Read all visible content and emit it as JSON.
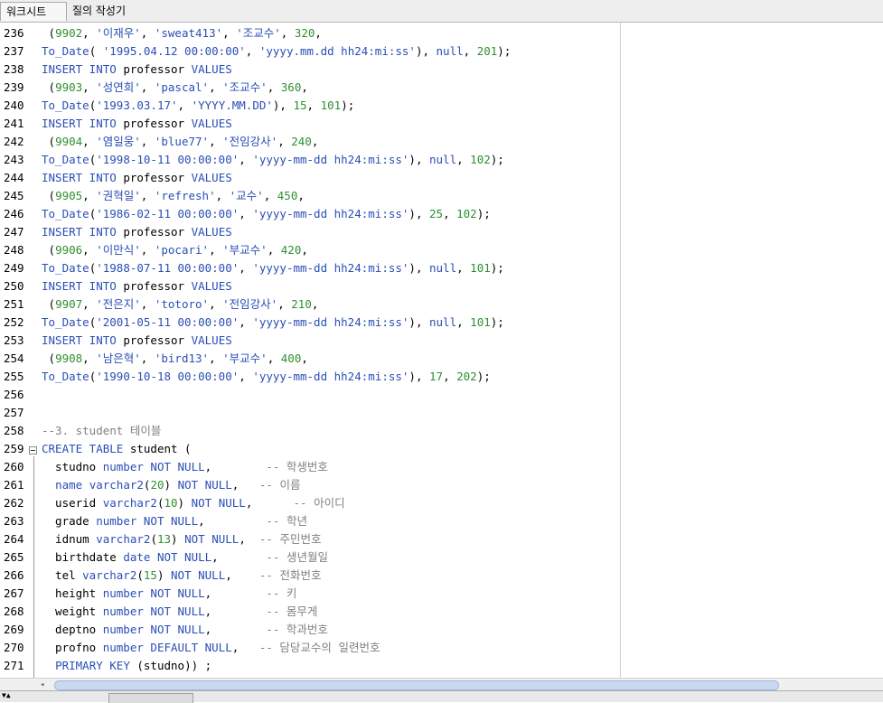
{
  "tabs": [
    {
      "label": "워크시트",
      "active": true
    },
    {
      "label": "질의 작성기",
      "active": false
    }
  ],
  "colors": {
    "keyword": "#2a4fb6",
    "number": "#2f8f2f",
    "comment": "#808080"
  },
  "lines": [
    {
      "n": "236",
      "tokens": [
        [
          "p",
          " ("
        ],
        [
          "num",
          "9902"
        ],
        [
          "p",
          ", "
        ],
        [
          "str",
          "'이재우'"
        ],
        [
          "p",
          ", "
        ],
        [
          "str",
          "'sweat413'"
        ],
        [
          "p",
          ", "
        ],
        [
          "str",
          "'조교수'"
        ],
        [
          "p",
          ", "
        ],
        [
          "num",
          "320"
        ],
        [
          "p",
          ","
        ]
      ]
    },
    {
      "n": "237",
      "tokens": [
        [
          "kw",
          "To_Date"
        ],
        [
          "p",
          "( "
        ],
        [
          "str",
          "'1995.04.12 00:00:00'"
        ],
        [
          "p",
          ", "
        ],
        [
          "str",
          "'yyyy.mm.dd hh24:mi:ss'"
        ],
        [
          "p",
          "), "
        ],
        [
          "kw",
          "null"
        ],
        [
          "p",
          ", "
        ],
        [
          "num",
          "201"
        ],
        [
          "p",
          ");"
        ]
      ]
    },
    {
      "n": "238",
      "tokens": [
        [
          "kw",
          "INSERT INTO"
        ],
        [
          "p",
          " professor "
        ],
        [
          "kw",
          "VALUES"
        ]
      ]
    },
    {
      "n": "239",
      "tokens": [
        [
          "p",
          " ("
        ],
        [
          "num",
          "9903"
        ],
        [
          "p",
          ", "
        ],
        [
          "str",
          "'성연희'"
        ],
        [
          "p",
          ", "
        ],
        [
          "str",
          "'pascal'"
        ],
        [
          "p",
          ", "
        ],
        [
          "str",
          "'조교수'"
        ],
        [
          "p",
          ", "
        ],
        [
          "num",
          "360"
        ],
        [
          "p",
          ","
        ]
      ]
    },
    {
      "n": "240",
      "tokens": [
        [
          "kw",
          "To_Date"
        ],
        [
          "p",
          "("
        ],
        [
          "str",
          "'1993.03.17'"
        ],
        [
          "p",
          ", "
        ],
        [
          "str",
          "'YYYY.MM.DD'"
        ],
        [
          "p",
          "), "
        ],
        [
          "num",
          "15"
        ],
        [
          "p",
          ", "
        ],
        [
          "num",
          "101"
        ],
        [
          "p",
          ");"
        ]
      ]
    },
    {
      "n": "241",
      "tokens": [
        [
          "kw",
          "INSERT INTO"
        ],
        [
          "p",
          " professor "
        ],
        [
          "kw",
          "VALUES"
        ]
      ]
    },
    {
      "n": "242",
      "tokens": [
        [
          "p",
          " ("
        ],
        [
          "num",
          "9904"
        ],
        [
          "p",
          ", "
        ],
        [
          "str",
          "'염일웅'"
        ],
        [
          "p",
          ", "
        ],
        [
          "str",
          "'blue77'"
        ],
        [
          "p",
          ", "
        ],
        [
          "str",
          "'전임강사'"
        ],
        [
          "p",
          ", "
        ],
        [
          "num",
          "240"
        ],
        [
          "p",
          ","
        ]
      ]
    },
    {
      "n": "243",
      "tokens": [
        [
          "kw",
          "To_Date"
        ],
        [
          "p",
          "("
        ],
        [
          "str",
          "'1998-10-11 00:00:00'"
        ],
        [
          "p",
          ", "
        ],
        [
          "str",
          "'yyyy-mm-dd hh24:mi:ss'"
        ],
        [
          "p",
          "), "
        ],
        [
          "kw",
          "null"
        ],
        [
          "p",
          ", "
        ],
        [
          "num",
          "102"
        ],
        [
          "p",
          ");"
        ]
      ]
    },
    {
      "n": "244",
      "tokens": [
        [
          "kw",
          "INSERT INTO"
        ],
        [
          "p",
          " professor "
        ],
        [
          "kw",
          "VALUES"
        ]
      ]
    },
    {
      "n": "245",
      "tokens": [
        [
          "p",
          " ("
        ],
        [
          "num",
          "9905"
        ],
        [
          "p",
          ", "
        ],
        [
          "str",
          "'권혁일'"
        ],
        [
          "p",
          ", "
        ],
        [
          "str",
          "'refresh'"
        ],
        [
          "p",
          ", "
        ],
        [
          "str",
          "'교수'"
        ],
        [
          "p",
          ", "
        ],
        [
          "num",
          "450"
        ],
        [
          "p",
          ","
        ]
      ]
    },
    {
      "n": "246",
      "tokens": [
        [
          "kw",
          "To_Date"
        ],
        [
          "p",
          "("
        ],
        [
          "str",
          "'1986-02-11 00:00:00'"
        ],
        [
          "p",
          ", "
        ],
        [
          "str",
          "'yyyy-mm-dd hh24:mi:ss'"
        ],
        [
          "p",
          "), "
        ],
        [
          "num",
          "25"
        ],
        [
          "p",
          ", "
        ],
        [
          "num",
          "102"
        ],
        [
          "p",
          ");"
        ]
      ]
    },
    {
      "n": "247",
      "tokens": [
        [
          "kw",
          "INSERT INTO"
        ],
        [
          "p",
          " professor "
        ],
        [
          "kw",
          "VALUES"
        ]
      ]
    },
    {
      "n": "248",
      "tokens": [
        [
          "p",
          " ("
        ],
        [
          "num",
          "9906"
        ],
        [
          "p",
          ", "
        ],
        [
          "str",
          "'이만식'"
        ],
        [
          "p",
          ", "
        ],
        [
          "str",
          "'pocari'"
        ],
        [
          "p",
          ", "
        ],
        [
          "str",
          "'부교수'"
        ],
        [
          "p",
          ", "
        ],
        [
          "num",
          "420"
        ],
        [
          "p",
          ","
        ]
      ]
    },
    {
      "n": "249",
      "tokens": [
        [
          "kw",
          "To_Date"
        ],
        [
          "p",
          "("
        ],
        [
          "str",
          "'1988-07-11 00:00:00'"
        ],
        [
          "p",
          ", "
        ],
        [
          "str",
          "'yyyy-mm-dd hh24:mi:ss'"
        ],
        [
          "p",
          "), "
        ],
        [
          "kw",
          "null"
        ],
        [
          "p",
          ", "
        ],
        [
          "num",
          "101"
        ],
        [
          "p",
          ");"
        ]
      ]
    },
    {
      "n": "250",
      "tokens": [
        [
          "kw",
          "INSERT INTO"
        ],
        [
          "p",
          " professor "
        ],
        [
          "kw",
          "VALUES"
        ]
      ]
    },
    {
      "n": "251",
      "tokens": [
        [
          "p",
          " ("
        ],
        [
          "num",
          "9907"
        ],
        [
          "p",
          ", "
        ],
        [
          "str",
          "'전은지'"
        ],
        [
          "p",
          ", "
        ],
        [
          "str",
          "'totoro'"
        ],
        [
          "p",
          ", "
        ],
        [
          "str",
          "'전임강사'"
        ],
        [
          "p",
          ", "
        ],
        [
          "num",
          "210"
        ],
        [
          "p",
          ","
        ]
      ]
    },
    {
      "n": "252",
      "tokens": [
        [
          "kw",
          "To_Date"
        ],
        [
          "p",
          "("
        ],
        [
          "str",
          "'2001-05-11 00:00:00'"
        ],
        [
          "p",
          ", "
        ],
        [
          "str",
          "'yyyy-mm-dd hh24:mi:ss'"
        ],
        [
          "p",
          "), "
        ],
        [
          "kw",
          "null"
        ],
        [
          "p",
          ", "
        ],
        [
          "num",
          "101"
        ],
        [
          "p",
          ");"
        ]
      ]
    },
    {
      "n": "253",
      "tokens": [
        [
          "kw",
          "INSERT INTO"
        ],
        [
          "p",
          " professor "
        ],
        [
          "kw",
          "VALUES"
        ]
      ]
    },
    {
      "n": "254",
      "tokens": [
        [
          "p",
          " ("
        ],
        [
          "num",
          "9908"
        ],
        [
          "p",
          ", "
        ],
        [
          "str",
          "'남은혁'"
        ],
        [
          "p",
          ", "
        ],
        [
          "str",
          "'bird13'"
        ],
        [
          "p",
          ", "
        ],
        [
          "str",
          "'부교수'"
        ],
        [
          "p",
          ", "
        ],
        [
          "num",
          "400"
        ],
        [
          "p",
          ","
        ]
      ]
    },
    {
      "n": "255",
      "tokens": [
        [
          "kw",
          "To_Date"
        ],
        [
          "p",
          "("
        ],
        [
          "str",
          "'1990-10-18 00:00:00'"
        ],
        [
          "p",
          ", "
        ],
        [
          "str",
          "'yyyy-mm-dd hh24:mi:ss'"
        ],
        [
          "p",
          "), "
        ],
        [
          "num",
          "17"
        ],
        [
          "p",
          ", "
        ],
        [
          "num",
          "202"
        ],
        [
          "p",
          ");"
        ]
      ]
    },
    {
      "n": "256",
      "tokens": []
    },
    {
      "n": "257",
      "tokens": []
    },
    {
      "n": "258",
      "tokens": [
        [
          "cmt",
          "--3. student 테이블"
        ]
      ]
    },
    {
      "n": "259",
      "tokens": [
        [
          "kw",
          "CREATE TABLE"
        ],
        [
          "p",
          " student ("
        ]
      ]
    },
    {
      "n": "260",
      "tokens": [
        [
          "p",
          "  studno "
        ],
        [
          "kw",
          "number NOT NULL"
        ],
        [
          "p",
          ",        "
        ],
        [
          "cmt",
          "-- 학생번호"
        ]
      ]
    },
    {
      "n": "261",
      "tokens": [
        [
          "p",
          "  "
        ],
        [
          "kw",
          "name varchar2"
        ],
        [
          "p",
          "("
        ],
        [
          "num",
          "20"
        ],
        [
          "p",
          ") "
        ],
        [
          "kw",
          "NOT NULL"
        ],
        [
          "p",
          ",   "
        ],
        [
          "cmt",
          "-- 이름"
        ]
      ]
    },
    {
      "n": "262",
      "tokens": [
        [
          "p",
          "  userid "
        ],
        [
          "kw",
          "varchar2"
        ],
        [
          "p",
          "("
        ],
        [
          "num",
          "10"
        ],
        [
          "p",
          ") "
        ],
        [
          "kw",
          "NOT NULL"
        ],
        [
          "p",
          ",      "
        ],
        [
          "cmt",
          "-- 아이디"
        ]
      ]
    },
    {
      "n": "263",
      "tokens": [
        [
          "p",
          "  grade "
        ],
        [
          "kw",
          "number NOT NULL"
        ],
        [
          "p",
          ",         "
        ],
        [
          "cmt",
          "-- 학년"
        ]
      ]
    },
    {
      "n": "264",
      "tokens": [
        [
          "p",
          "  idnum "
        ],
        [
          "kw",
          "varchar2"
        ],
        [
          "p",
          "("
        ],
        [
          "num",
          "13"
        ],
        [
          "p",
          ") "
        ],
        [
          "kw",
          "NOT NULL"
        ],
        [
          "p",
          ",  "
        ],
        [
          "cmt",
          "-- 주민번호"
        ]
      ]
    },
    {
      "n": "265",
      "tokens": [
        [
          "p",
          "  birthdate "
        ],
        [
          "kw",
          "date NOT NULL"
        ],
        [
          "p",
          ",       "
        ],
        [
          "cmt",
          "-- 생년월일"
        ]
      ]
    },
    {
      "n": "266",
      "tokens": [
        [
          "p",
          "  tel "
        ],
        [
          "kw",
          "varchar2"
        ],
        [
          "p",
          "("
        ],
        [
          "num",
          "15"
        ],
        [
          "p",
          ") "
        ],
        [
          "kw",
          "NOT NULL"
        ],
        [
          "p",
          ",    "
        ],
        [
          "cmt",
          "-- 전화번호"
        ]
      ]
    },
    {
      "n": "267",
      "tokens": [
        [
          "p",
          "  height "
        ],
        [
          "kw",
          "number NOT NULL"
        ],
        [
          "p",
          ",        "
        ],
        [
          "cmt",
          "-- 키"
        ]
      ]
    },
    {
      "n": "268",
      "tokens": [
        [
          "p",
          "  weight "
        ],
        [
          "kw",
          "number NOT NULL"
        ],
        [
          "p",
          ",        "
        ],
        [
          "cmt",
          "-- 몸무게"
        ]
      ]
    },
    {
      "n": "269",
      "tokens": [
        [
          "p",
          "  deptno "
        ],
        [
          "kw",
          "number NOT NULL"
        ],
        [
          "p",
          ",        "
        ],
        [
          "cmt",
          "-- 학과번호"
        ]
      ]
    },
    {
      "n": "270",
      "tokens": [
        [
          "p",
          "  profno "
        ],
        [
          "kw",
          "number DEFAULT NULL"
        ],
        [
          "p",
          ",   "
        ],
        [
          "cmt",
          "-- 담당교수의 일련번호"
        ]
      ]
    },
    {
      "n": "271",
      "tokens": [
        [
          "p",
          "  "
        ],
        [
          "kw",
          "PRIMARY KEY"
        ],
        [
          "p",
          " (studno)) ;"
        ]
      ]
    }
  ]
}
